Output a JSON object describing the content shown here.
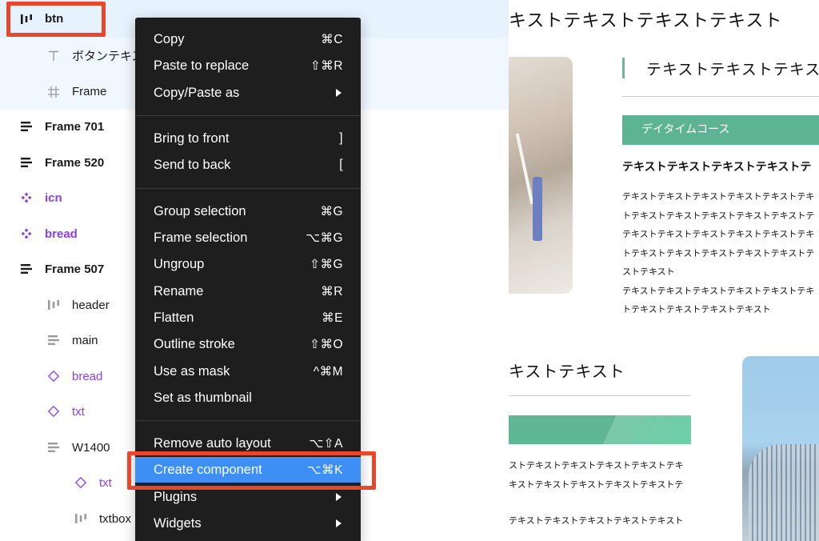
{
  "layers": [
    {
      "label": "btn",
      "icon": "horizontal-auto-layout-icon",
      "style": "bold",
      "state": "selected"
    },
    {
      "label": "ボタンテキスト",
      "icon": "text-layer-icon",
      "style": "normal",
      "state": "selected-child"
    },
    {
      "label": "Frame",
      "icon": "frame-hash-icon",
      "style": "normal",
      "state": "selected-child"
    },
    {
      "label": "Frame 701",
      "icon": "vertical-auto-layout-icon",
      "style": "bold",
      "state": ""
    },
    {
      "label": "Frame 520",
      "icon": "vertical-auto-layout-icon",
      "style": "bold",
      "state": ""
    },
    {
      "label": "icn",
      "icon": "component-icon",
      "style": "bold-purple",
      "state": ""
    },
    {
      "label": "bread",
      "icon": "component-icon",
      "style": "bold-purple",
      "state": ""
    },
    {
      "label": "Frame 507",
      "icon": "vertical-auto-layout-icon",
      "style": "bold",
      "state": ""
    },
    {
      "label": "header",
      "icon": "horizontal-auto-layout-icon",
      "style": "normal",
      "state": ""
    },
    {
      "label": "main",
      "icon": "vertical-auto-layout-icon",
      "style": "normal",
      "state": ""
    },
    {
      "label": "bread",
      "icon": "instance-icon",
      "style": "purple",
      "state": ""
    },
    {
      "label": "txt",
      "icon": "instance-icon",
      "style": "purple",
      "state": ""
    },
    {
      "label": "W1400",
      "icon": "vertical-auto-layout-icon",
      "style": "normal",
      "state": ""
    },
    {
      "label": "txt",
      "icon": "instance-icon",
      "style": "purple",
      "state": ""
    },
    {
      "label": "txtbox",
      "icon": "horizontal-auto-layout-icon",
      "style": "normal",
      "state": ""
    }
  ],
  "menu": {
    "groups": [
      [
        {
          "label": "Copy",
          "shortcut": "⌘C"
        },
        {
          "label": "Paste to replace",
          "shortcut": "⇧⌘R"
        },
        {
          "label": "Copy/Paste as",
          "submenu": true
        }
      ],
      [
        {
          "label": "Bring to front",
          "shortcut": "]"
        },
        {
          "label": "Send to back",
          "shortcut": "["
        }
      ],
      [
        {
          "label": "Group selection",
          "shortcut": "⌘G"
        },
        {
          "label": "Frame selection",
          "shortcut": "⌥⌘G"
        },
        {
          "label": "Ungroup",
          "shortcut": "⇧⌘G"
        },
        {
          "label": "Rename",
          "shortcut": "⌘R"
        },
        {
          "label": "Flatten",
          "shortcut": "⌘E"
        },
        {
          "label": "Outline stroke",
          "shortcut": "⇧⌘O"
        },
        {
          "label": "Use as mask",
          "shortcut": "^⌘M"
        },
        {
          "label": "Set as thumbnail",
          "shortcut": ""
        }
      ],
      [
        {
          "label": "Remove auto layout",
          "shortcut": "⌥⇧A"
        },
        {
          "label": "Create component",
          "shortcut": "⌥⌘K",
          "highlighted": true
        },
        {
          "label": "Plugins",
          "submenu": true
        },
        {
          "label": "Widgets",
          "submenu": true
        }
      ]
    ]
  },
  "canvas": {
    "heading1": "キストテキストテキストテキスト",
    "heading2": "テキストテキストテキスト",
    "course_label": "デイタイムコース",
    "subheading": "テキストテキストテキストテキストテ",
    "body_lines": [
      "テキストテキストテキストテキストテキストテキ",
      "トテキストテキストテキストテキストテキストテ",
      "テキストテキストテキストテキストテキストテキ",
      "トテキストテキストテキストテキストテキストテ",
      "ストテキスト",
      "テキストテキストテキストテキストテキストテキ",
      "トテキストテキストテキストテキスト"
    ],
    "heading3": "キストテキスト",
    "body2_lines": [
      "ストテキストテキストテキストテキストテキ",
      "キストテキストテキストテキストテキストテ"
    ],
    "body3": "テキストテキストテキストテキストテキスト"
  },
  "colors": {
    "menu_bg": "#1e1e1e",
    "menu_highlight": "#3d8ff5",
    "selection_bg": "#e6f2fd",
    "component_purple": "#8a3ff0",
    "annotation_red": "#e8472c",
    "course_green": "#5db494"
  }
}
